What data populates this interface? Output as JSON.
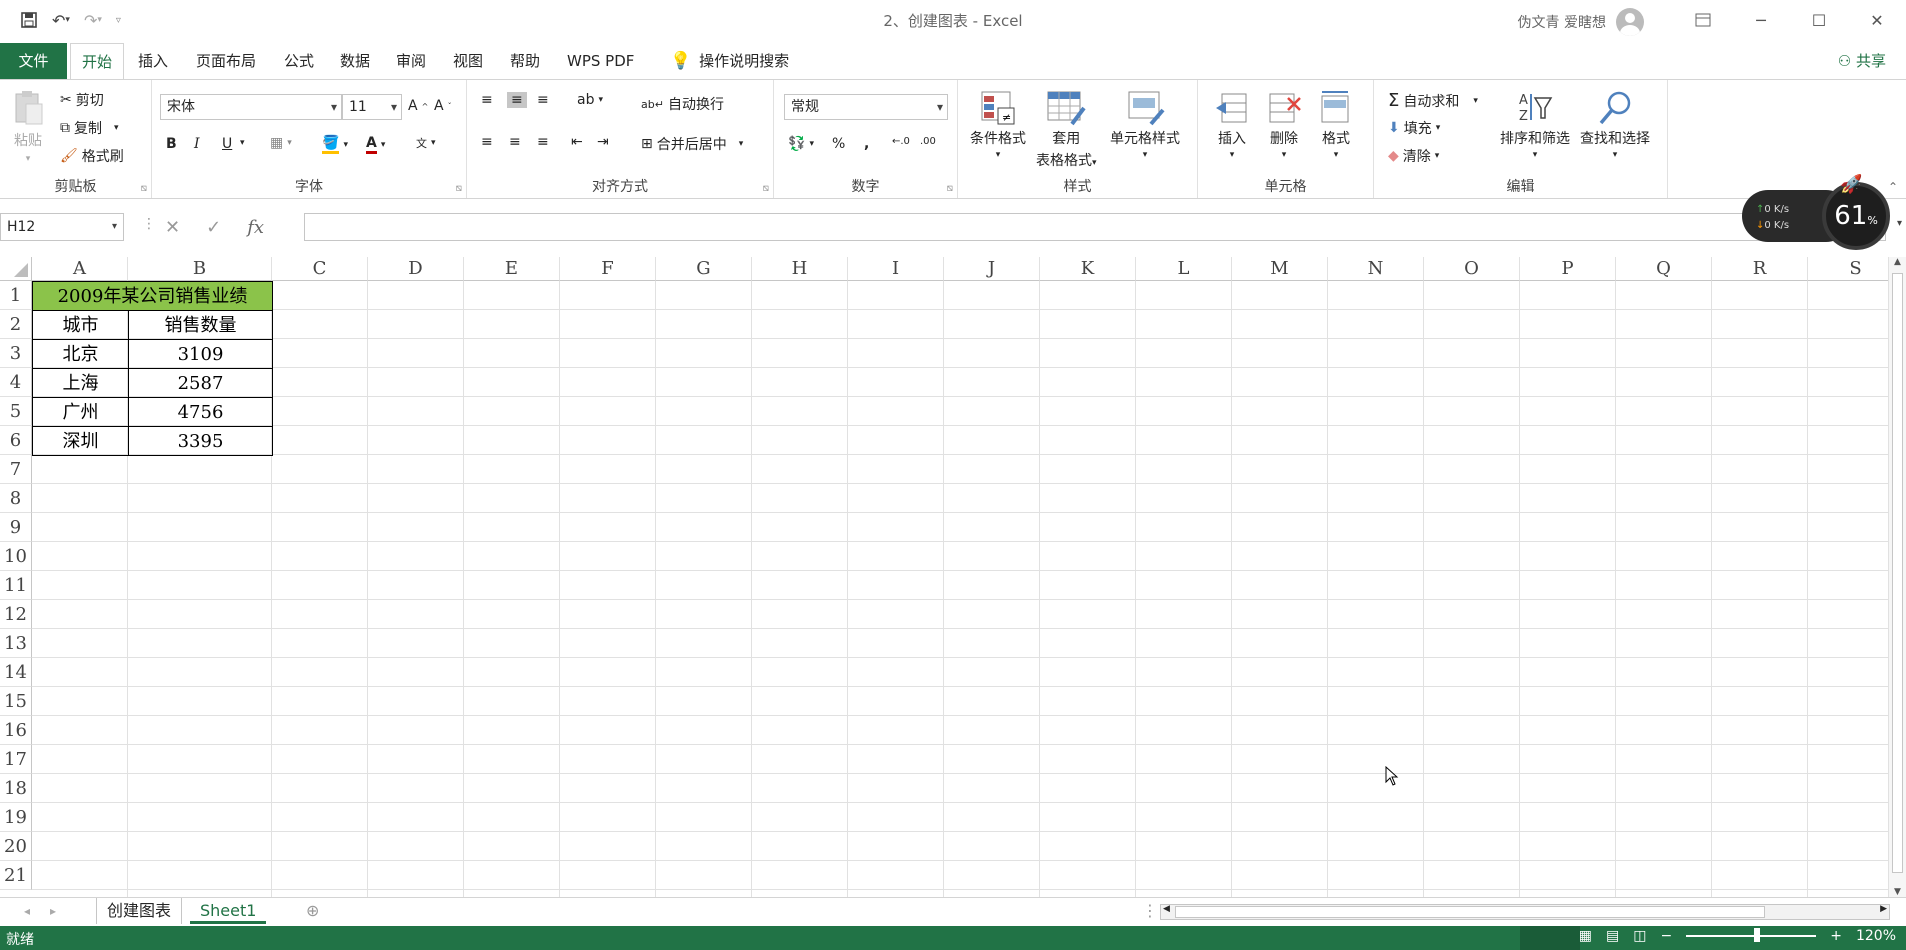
{
  "window": {
    "title": "2、创建图表 - Excel",
    "user": "伪文青 爱瞎想"
  },
  "qat": {
    "save": "save-icon",
    "undo": "undo-icon",
    "redo": "redo-icon",
    "customize": "customize-icon"
  },
  "menu": {
    "file": "文件",
    "tabs": [
      "开始",
      "插入",
      "页面布局",
      "公式",
      "数据",
      "审阅",
      "视图",
      "帮助",
      "WPS PDF"
    ],
    "tell_me": "操作说明搜索",
    "share": "共享"
  },
  "ribbon": {
    "clipboard": {
      "label": "剪贴板",
      "paste": "粘贴",
      "cut": "剪切",
      "copy": "复制",
      "format_painter": "格式刷"
    },
    "font": {
      "label": "字体",
      "name": "宋体",
      "size": "11",
      "bold": "B",
      "italic": "I",
      "underline": "U"
    },
    "alignment": {
      "label": "对齐方式",
      "wrap": "自动换行",
      "merge": "合并后居中"
    },
    "number": {
      "label": "数字",
      "format": "常规",
      "percent": "%",
      "comma": ","
    },
    "styles": {
      "label": "样式",
      "conditional": "条件格式",
      "table_line1": "套用",
      "table_line2": "表格格式",
      "cell_styles": "单元格样式"
    },
    "cells": {
      "label": "单元格",
      "insert": "插入",
      "delete": "删除",
      "format": "格式"
    },
    "editing": {
      "label": "编辑",
      "autosum": "自动求和",
      "fill": "填充",
      "clear": "清除",
      "sort_filter": "排序和筛选",
      "find_select": "查找和选择"
    }
  },
  "formula_bar": {
    "name_box": "H12",
    "fx": "fx",
    "value": ""
  },
  "net_widget": {
    "up": "0  K/s",
    "down": "0  K/s",
    "percent": "61",
    "unit": "%"
  },
  "columns": [
    "A",
    "B",
    "C",
    "D",
    "E",
    "F",
    "G",
    "H",
    "I",
    "J",
    "K",
    "L",
    "M",
    "N",
    "O",
    "P",
    "Q",
    "R",
    "S"
  ],
  "rows": [
    "1",
    "2",
    "3",
    "4",
    "5",
    "6",
    "7",
    "8",
    "9",
    "10",
    "11",
    "12",
    "13",
    "14",
    "15",
    "16",
    "17",
    "18",
    "19",
    "20",
    "21"
  ],
  "table": {
    "title": "2009年某公司销售业绩",
    "headers": [
      "城市",
      "销售数量"
    ],
    "data": [
      [
        "北京",
        "3109"
      ],
      [
        "上海",
        "2587"
      ],
      [
        "广州",
        "4756"
      ],
      [
        "深圳",
        "3395"
      ]
    ]
  },
  "sheets": [
    "创建图表",
    "Sheet1"
  ],
  "status": {
    "ready": "就绪",
    "zoom": "120%"
  },
  "colors": {
    "accent": "#217346",
    "title_fill": "#8bc34a"
  }
}
